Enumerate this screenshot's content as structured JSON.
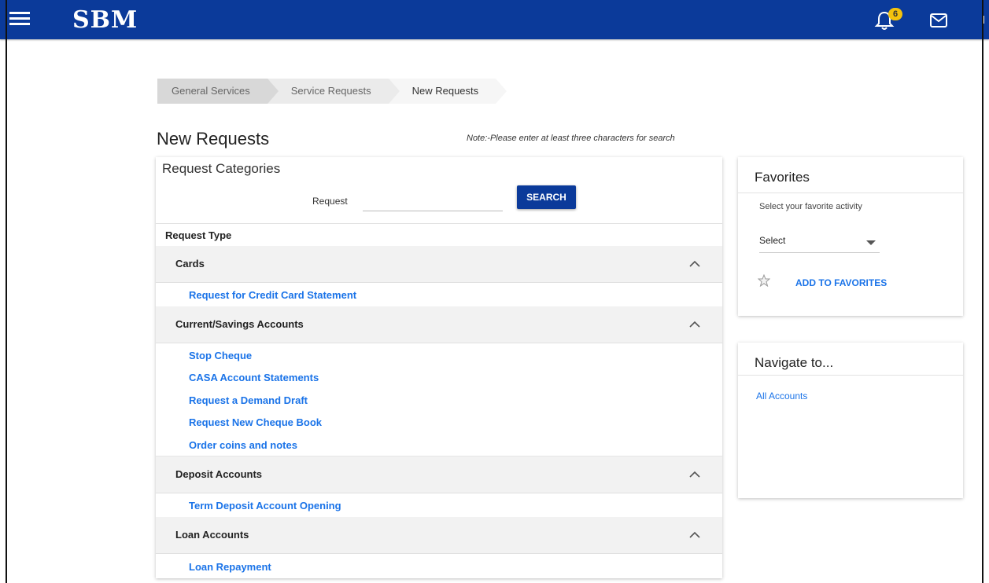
{
  "header": {
    "brand": "SBM",
    "notification_count": "6",
    "colors": {
      "bar": "#0b3a9a",
      "badge": "#f4c20d",
      "link": "#1a73e8"
    }
  },
  "breadcrumb": {
    "items": [
      {
        "label": "General Services"
      },
      {
        "label": "Service Requests"
      },
      {
        "label": "New Requests"
      }
    ]
  },
  "page": {
    "title": "New Requests",
    "note": "Note:-Please enter at least three characters for search"
  },
  "request_categories": {
    "title": "Request Categories",
    "search_label": "Request",
    "search_value": "",
    "search_button": "SEARCH",
    "request_type_label": "Request Type",
    "groups": [
      {
        "name": "Cards",
        "items": [
          "Request for Credit Card Statement"
        ]
      },
      {
        "name": "Current/Savings Accounts",
        "items": [
          "Stop Cheque",
          "CASA Account Statements",
          "Request a Demand Draft",
          "Request New Cheque Book",
          "Order coins and notes"
        ]
      },
      {
        "name": "Deposit Accounts",
        "items": [
          "Term Deposit Account Opening"
        ]
      },
      {
        "name": "Loan Accounts",
        "items": [
          "Loan Repayment"
        ]
      }
    ]
  },
  "favorites": {
    "title": "Favorites",
    "subtitle": "Select your favorite activity",
    "select_value": "Select",
    "add_label": "ADD TO FAVORITES"
  },
  "navigate": {
    "title": "Navigate to...",
    "links": [
      "All Accounts"
    ]
  }
}
